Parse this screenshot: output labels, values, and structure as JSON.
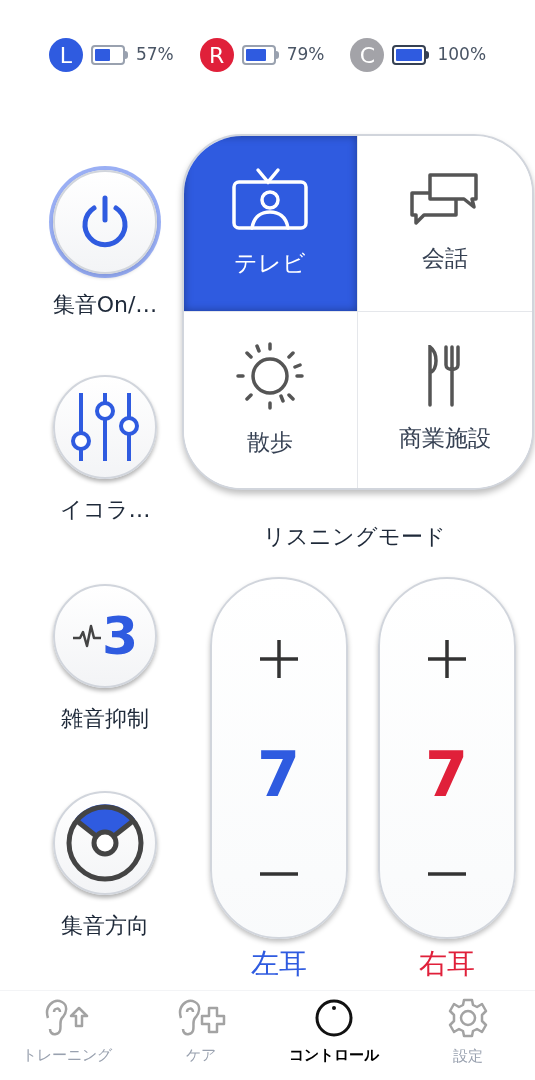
{
  "devices": [
    {
      "letter": "L",
      "color": "#2f5be0",
      "percent": "57%"
    },
    {
      "letter": "R",
      "color": "#e0203a",
      "percent": "79%"
    },
    {
      "letter": "C",
      "color": "#a3a3a8",
      "percent": "100%"
    }
  ],
  "controls": [
    {
      "kind": "power",
      "label": "集音On/…",
      "on": true
    },
    {
      "kind": "equalizer",
      "label": "イコラ…"
    },
    {
      "kind": "noise",
      "label": "雑音抑制",
      "value": "3"
    },
    {
      "kind": "direction",
      "label": "集音方向"
    }
  ],
  "listening_mode": {
    "title": "リスニングモード",
    "modes": [
      {
        "kind": "tv",
        "label": "テレビ",
        "selected": true
      },
      {
        "kind": "chat",
        "label": "会話",
        "selected": false
      },
      {
        "kind": "sun",
        "label": "散歩",
        "selected": false
      },
      {
        "kind": "cutlery",
        "label": "商業施設",
        "selected": false
      }
    ]
  },
  "volume": [
    {
      "value": "7",
      "label": "左耳",
      "color": "#2f5be0"
    },
    {
      "value": "7",
      "label": "右耳",
      "color": "#e0203a"
    }
  ],
  "tabs": [
    {
      "kind": "ear-up",
      "label": "トレーニング",
      "selected": false
    },
    {
      "kind": "ear-plus",
      "label": "ケア",
      "selected": false
    },
    {
      "kind": "knob",
      "label": "コントロール",
      "selected": true
    },
    {
      "kind": "gear",
      "label": "設定",
      "selected": false
    }
  ]
}
